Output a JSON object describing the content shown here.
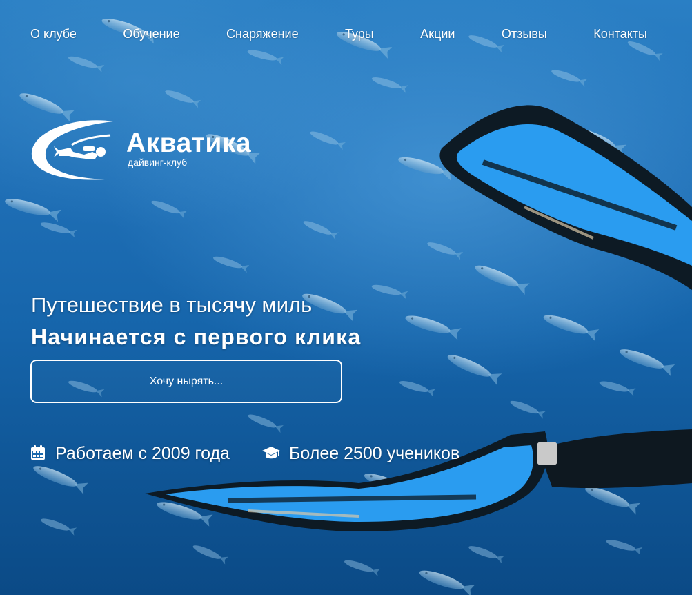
{
  "nav": {
    "items": [
      {
        "label": "О клубе"
      },
      {
        "label": "Обучение"
      },
      {
        "label": "Снаряжение"
      },
      {
        "label": "Туры"
      },
      {
        "label": "Акции"
      },
      {
        "label": "Отзывы"
      },
      {
        "label": "Контакты"
      }
    ]
  },
  "logo": {
    "brand": "Акватика",
    "tagline": "дайвинг-клуб",
    "icon": "diver-swoosh-logo"
  },
  "hero": {
    "subtitle": "Путешествие в тысячу миль",
    "headline": "Начинается с первого клика",
    "cta_label": "Хочу нырять..."
  },
  "features": [
    {
      "icon": "calendar-icon",
      "text": "Работаем с 2009 года"
    },
    {
      "icon": "graduation-cap-icon",
      "text": "Более 2500 учеников"
    }
  ],
  "colors": {
    "water_top": "#2a7fc4",
    "water_bottom": "#0b4a86",
    "fin_blue": "#2a9cf0",
    "fin_black": "#0d1a24",
    "text": "#ffffff"
  }
}
